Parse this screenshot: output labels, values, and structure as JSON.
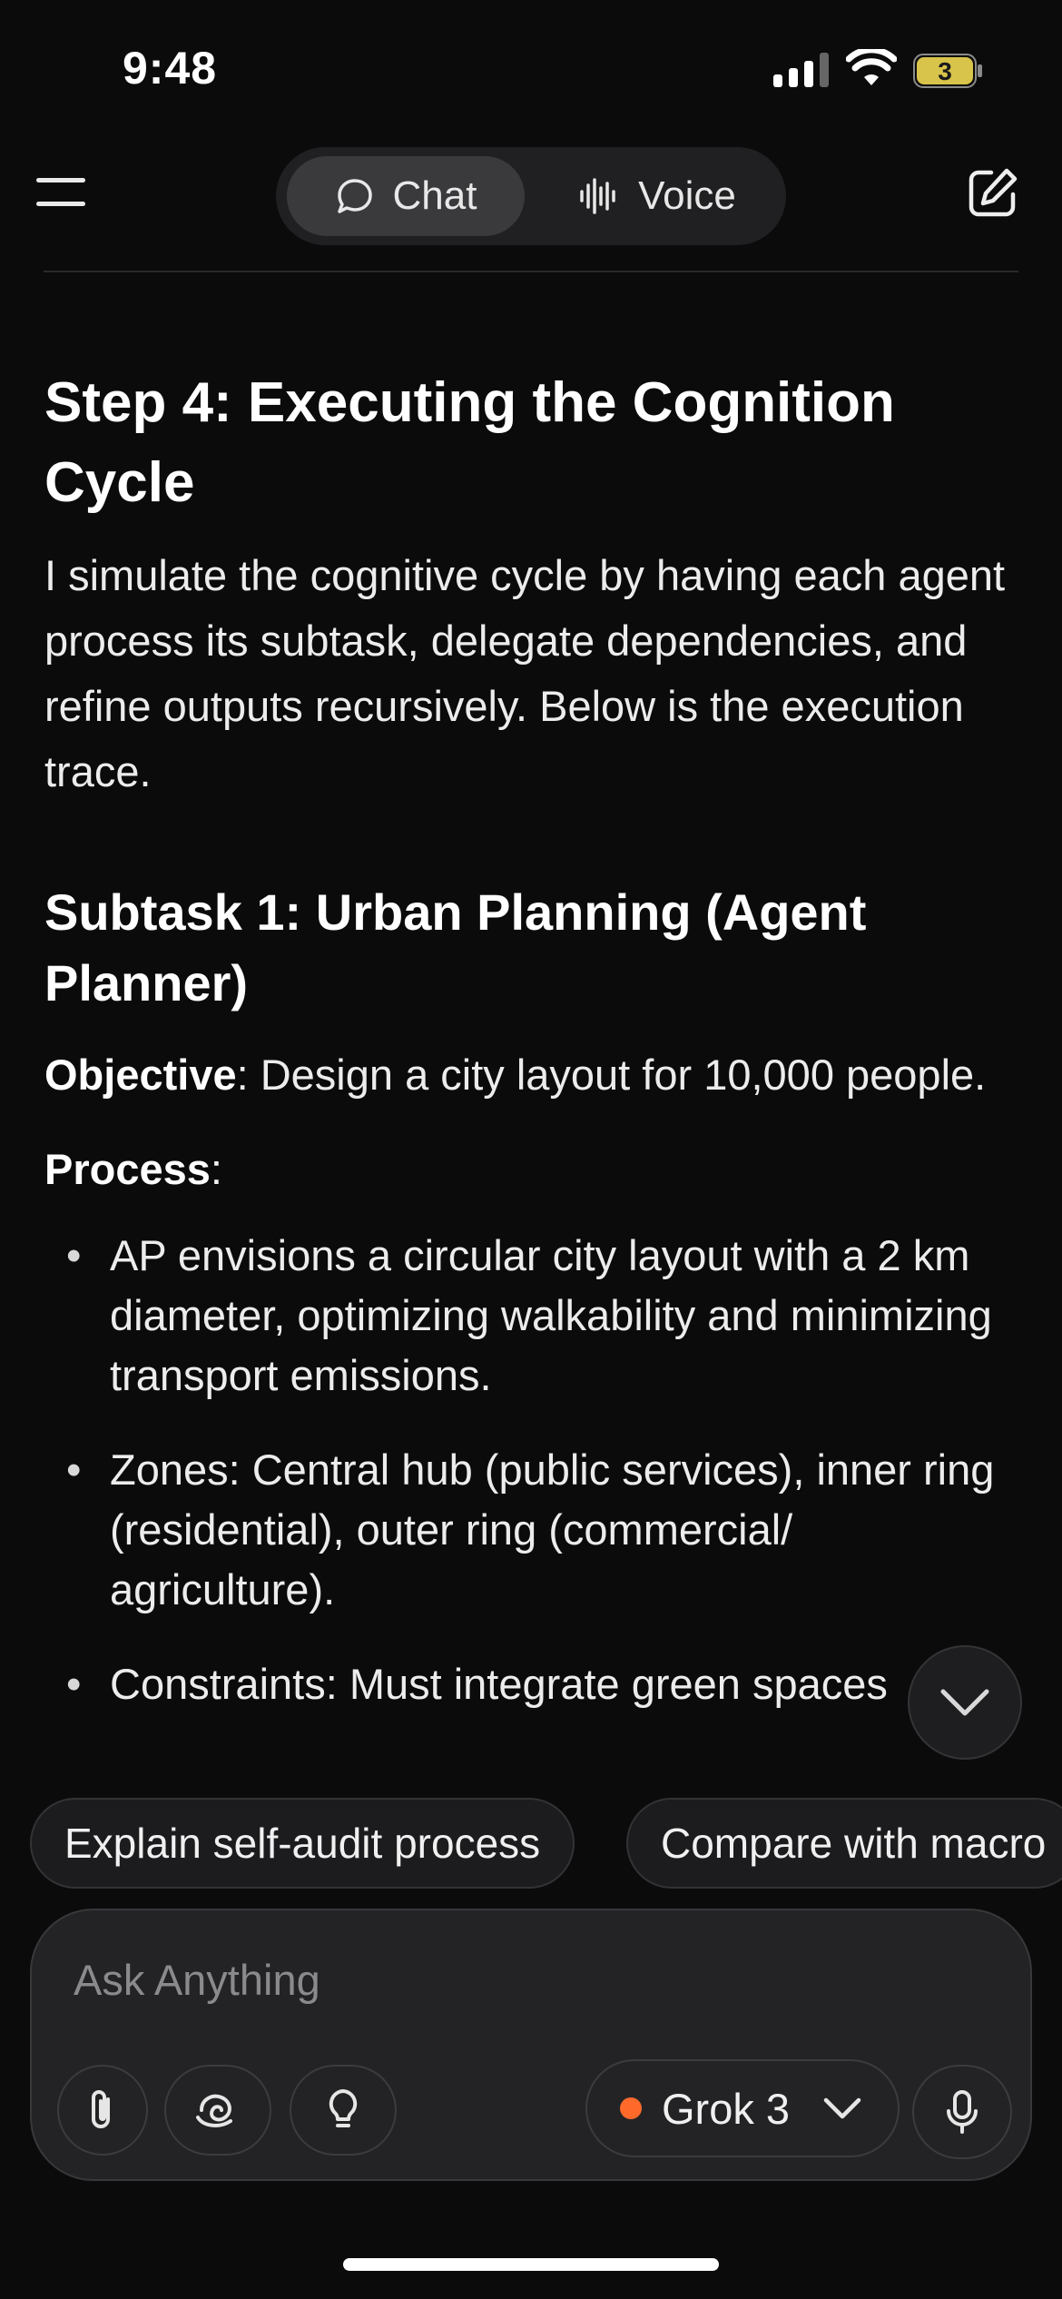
{
  "status_bar": {
    "time": "9:48",
    "battery_level": "3",
    "icons": [
      "signal-icon",
      "wifi-icon",
      "battery-icon"
    ]
  },
  "header": {
    "menu_icon": "hamburger-menu-icon",
    "modes": [
      {
        "label": "Chat",
        "icon": "chat-bubble-icon",
        "selected": true
      },
      {
        "label": "Voice",
        "icon": "voice-waveform-icon",
        "selected": false
      }
    ],
    "edit_icon": "new-chat-edit-icon"
  },
  "message": {
    "heading": "Step 4: Executing the Cognition Cycle",
    "intro": "I simulate the cognitive cycle by having each agent process its subtask, delegate dependencies, and refine outputs recursively. Below is the execution trace.",
    "subheading": "Subtask 1: Urban Planning (Agent Planner)",
    "objective_label": "Objective",
    "objective_text": ": Design a city layout for 10,000 people.",
    "process_label": "Process",
    "process_suffix": ":",
    "bullets": [
      "AP envisions a circular city layout with a 2 km diameter, optimizing walkability and minimizing transport emissions.",
      "Zones: Central hub (public services), inner ring (residential), outer ring (commercial/ agriculture).",
      "Constraints: Must integrate green spaces"
    ]
  },
  "scroll_down_icon": "chevron-down-icon",
  "suggestions": [
    "Explain self-audit process",
    "Compare with macro"
  ],
  "composer": {
    "placeholder": "Ask Anything",
    "tools": [
      "paperclip-icon",
      "deep-search-icon",
      "lightbulb-icon"
    ],
    "model": "Grok 3",
    "model_dot_color": "#ff6a2b",
    "mic_icon": "microphone-icon"
  }
}
